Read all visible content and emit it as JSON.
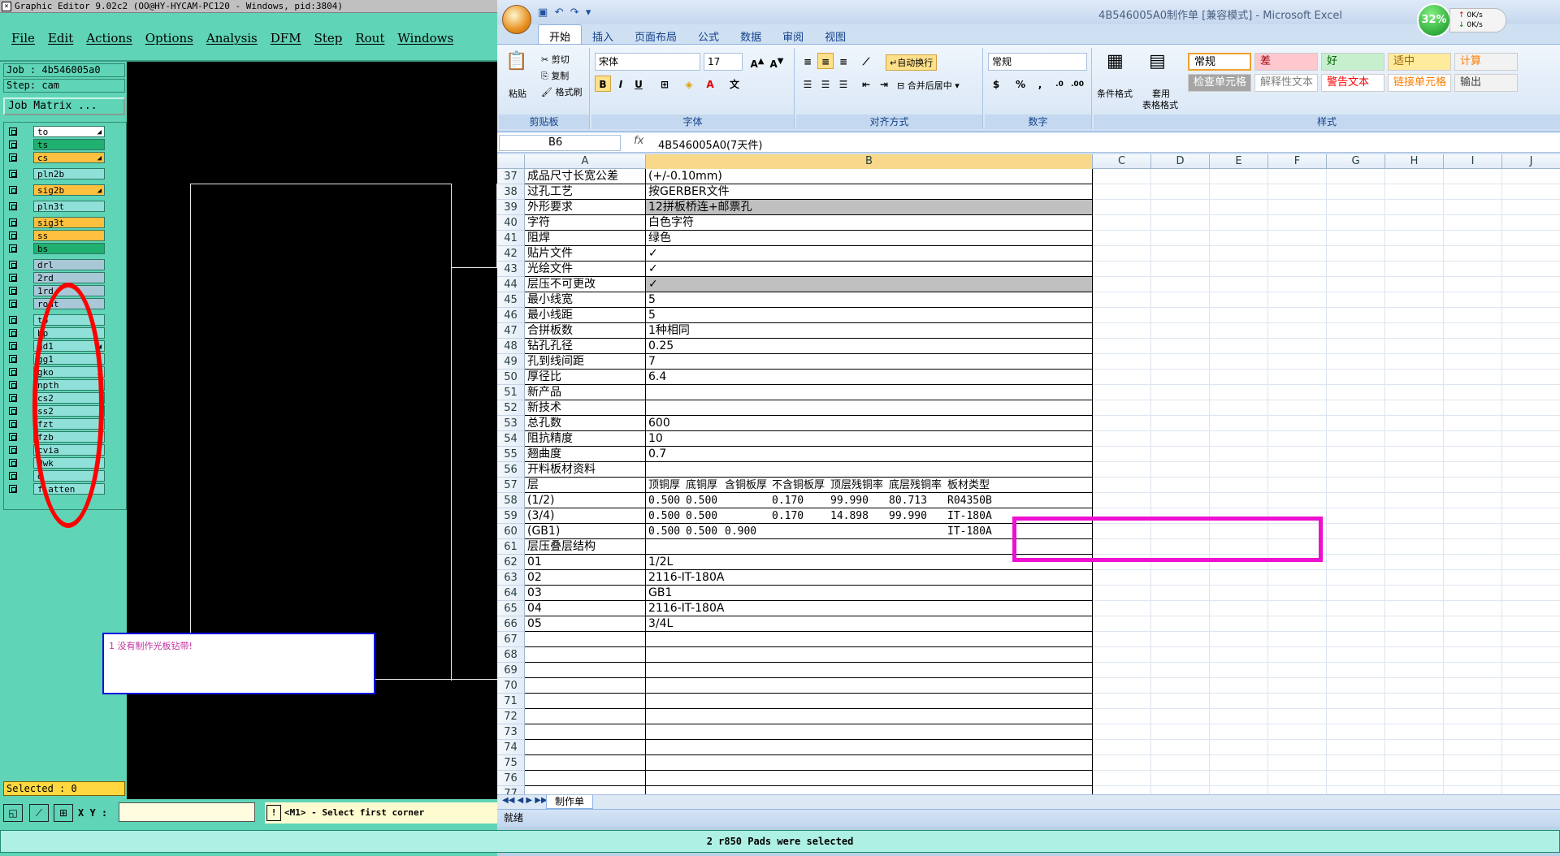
{
  "ge": {
    "title": "Graphic Editor 9.02c2 (OO@HY-HYCAM-PC120 - Windows, pid:3804)",
    "menu": [
      "File",
      "Edit",
      "Actions",
      "Options",
      "Analysis",
      "DFM",
      "Step",
      "Rout",
      "Windows"
    ],
    "job": "Job : 4b546005a0",
    "step": "Step: cam",
    "job_matrix": "Job Matrix ...",
    "layers": [
      {
        "name": "to",
        "color": "#ffffff",
        "arrow": true
      },
      {
        "name": "ts",
        "color": "#20b070",
        "arrow": false
      },
      {
        "name": "cs",
        "color": "#ffc040",
        "arrow": true
      },
      {
        "name": "pln2b",
        "color": "#8fe0d8",
        "arrow": false
      },
      {
        "name": "sig2b",
        "color": "#ffc040",
        "arrow": true
      },
      {
        "name": "pln3t",
        "color": "#8fe0d8",
        "arrow": false
      },
      {
        "name": "sig3t",
        "color": "#ffc040",
        "arrow": false
      },
      {
        "name": "ss",
        "color": "#ffc040",
        "arrow": false
      },
      {
        "name": "bs",
        "color": "#20b070",
        "arrow": false
      },
      {
        "name": "drl",
        "color": "#a8c8d8",
        "arrow": false
      },
      {
        "name": "2rd",
        "color": "#a8c8d8",
        "arrow": false
      },
      {
        "name": "1rd",
        "color": "#a8c8d8",
        "arrow": false
      },
      {
        "name": "rout",
        "color": "#a8c8d8",
        "arrow": false
      },
      {
        "name": "tp",
        "color": "#8fe0d8",
        "arrow": false
      },
      {
        "name": "bp",
        "color": "#8fe0d8",
        "arrow": false
      },
      {
        "name": "gd1",
        "color": "#8fe0d8",
        "arrow": true
      },
      {
        "name": "gg1",
        "color": "#8fe0d8",
        "arrow": false
      },
      {
        "name": "gko",
        "color": "#8fe0d8",
        "arrow": true
      },
      {
        "name": "npth",
        "color": "#8fe0d8",
        "arrow": false
      },
      {
        "name": "cs2",
        "color": "#8fe0d8",
        "arrow": false
      },
      {
        "name": "ss2",
        "color": "#8fe0d8",
        "arrow": false
      },
      {
        "name": "fzt",
        "color": "#8fe0d8",
        "arrow": false
      },
      {
        "name": "fzb",
        "color": "#8fe0d8",
        "arrow": false
      },
      {
        "name": "cvia",
        "color": "#8fe0d8",
        "arrow": false
      },
      {
        "name": "dwk",
        "color": "#8fe0d8",
        "arrow": false
      },
      {
        "name": "d",
        "color": "#8fe0d8",
        "arrow": false
      },
      {
        "name": "flatten",
        "color": "#8fe0d8",
        "arrow": false
      }
    ],
    "message": "1  没有制作光板钻带!",
    "selected": "Selected : 0",
    "xy_label": "X Y :",
    "prompt": "<M1> - Select first corner",
    "status": "2 r850 Pads were selected"
  },
  "xl": {
    "title": "4B546005A0制作单  [兼容模式] - Microsoft Excel",
    "net": {
      "percent": "32%",
      "up": "0K/s",
      "down": "0K/s"
    },
    "tabs": [
      "开始",
      "插入",
      "页面布局",
      "公式",
      "数据",
      "审阅",
      "视图"
    ],
    "ribbon": {
      "paste": "粘贴",
      "cut": "剪切",
      "copy": "复制",
      "format_painter": "格式刷",
      "clipboard": "剪贴板",
      "font_name": "宋体",
      "font_size": "17",
      "font": "字体",
      "wrap": "自动换行",
      "merge": "合并后居中",
      "alignment": "对齐方式",
      "number_format": "常规",
      "number": "数字",
      "cond_format": "条件格式",
      "table_format_1": "套用",
      "table_format_2": "表格格式",
      "styles": "样式",
      "style_cells": [
        {
          "label": "常规",
          "bg": "#ffffff",
          "fg": "#000000"
        },
        {
          "label": "差",
          "bg": "#ffc7ce",
          "fg": "#9c0006"
        },
        {
          "label": "好",
          "bg": "#c6efce",
          "fg": "#006100"
        },
        {
          "label": "适中",
          "bg": "#ffeb9c",
          "fg": "#9c6500"
        },
        {
          "label": "计算",
          "bg": "#f2f2f2",
          "fg": "#fa7d00"
        },
        {
          "label": "检查单元格",
          "bg": "#a5a5a5",
          "fg": "#ffffff"
        },
        {
          "label": "解释性文本",
          "bg": "#ffffff",
          "fg": "#7f7f7f"
        },
        {
          "label": "警告文本",
          "bg": "#ffffff",
          "fg": "#ff0000"
        },
        {
          "label": "链接单元格",
          "bg": "#ffffff",
          "fg": "#fa7d00"
        },
        {
          "label": "输出",
          "bg": "#f2f2f2",
          "fg": "#3f3f3f"
        }
      ]
    },
    "name_box": "B6",
    "fx": "fx",
    "formula": "4B546005A0(7天件)",
    "columns": [
      "A",
      "B",
      "C",
      "D",
      "E",
      "F",
      "G",
      "H",
      "I",
      "J"
    ],
    "rows": [
      {
        "n": "37",
        "a": "成品尺寸长宽公差",
        "b": "(+/-0.10mm)"
      },
      {
        "n": "38",
        "a": "过孔工艺",
        "b": "按GERBER文件"
      },
      {
        "n": "39",
        "a": "外形要求",
        "b": "12拼板桥连+邮票孔",
        "gray": true
      },
      {
        "n": "40",
        "a": "字符",
        "b": "白色字符"
      },
      {
        "n": "41",
        "a": "阻焊",
        "b": "绿色"
      },
      {
        "n": "42",
        "a": "贴片文件",
        "b": "✓"
      },
      {
        "n": "43",
        "a": "光绘文件",
        "b": "✓"
      },
      {
        "n": "44",
        "a": "层压不可更改",
        "b": "✓",
        "gray": true
      },
      {
        "n": "45",
        "a": "最小线宽",
        "b": "5"
      },
      {
        "n": "46",
        "a": "最小线距",
        "b": "5"
      },
      {
        "n": "47",
        "a": "合拼板数",
        "b": "1种相同"
      },
      {
        "n": "48",
        "a": "钻孔孔径",
        "b": "0.25"
      },
      {
        "n": "49",
        "a": "孔到线间距",
        "b": "7"
      },
      {
        "n": "50",
        "a": "厚径比",
        "b": "6.4"
      },
      {
        "n": "51",
        "a": "新产品",
        "b": ""
      },
      {
        "n": "52",
        "a": "新技术",
        "b": ""
      },
      {
        "n": "53",
        "a": "总孔数",
        "b": "600"
      },
      {
        "n": "54",
        "a": "阻抗精度",
        "b": "10"
      },
      {
        "n": "55",
        "a": "翘曲度",
        "b": "0.7"
      },
      {
        "n": "56",
        "a": "开料板材资料",
        "b": ""
      },
      {
        "n": "57",
        "a": "层",
        "b": "",
        "sub": [
          "顶铜厚",
          "底铜厚",
          "含铜板厚",
          "不含铜板厚",
          "顶层残铜率",
          "底层残铜率",
          "板材类型"
        ]
      },
      {
        "n": "58",
        "a": "(1/2)",
        "b": "",
        "sub": [
          "0.500",
          "0.500",
          "",
          "0.170",
          "99.990",
          "80.713",
          "R04350B"
        ]
      },
      {
        "n": "59",
        "a": "(3/4)",
        "b": "",
        "sub": [
          "0.500",
          "0.500",
          "",
          "0.170",
          "14.898",
          "99.990",
          "IT-180A"
        ]
      },
      {
        "n": "60",
        "a": "(GB1)",
        "b": "",
        "sub": [
          "0.500",
          "0.500",
          "0.900",
          "",
          "",
          "",
          "IT-180A"
        ]
      },
      {
        "n": "61",
        "a": "层压叠层结构",
        "b": ""
      },
      {
        "n": "62",
        "a": "01",
        "b": "1/2L"
      },
      {
        "n": "63",
        "a": "02",
        "b": "2116-IT-180A"
      },
      {
        "n": "64",
        "a": "03",
        "b": "GB1"
      },
      {
        "n": "65",
        "a": "04",
        "b": "2116-IT-180A"
      },
      {
        "n": "66",
        "a": "05",
        "b": "3/4L"
      },
      {
        "n": "67",
        "a": "",
        "b": ""
      },
      {
        "n": "68",
        "a": "",
        "b": ""
      },
      {
        "n": "69",
        "a": "",
        "b": ""
      },
      {
        "n": "70",
        "a": "",
        "b": ""
      },
      {
        "n": "71",
        "a": "",
        "b": ""
      },
      {
        "n": "72",
        "a": "",
        "b": ""
      },
      {
        "n": "73",
        "a": "",
        "b": ""
      },
      {
        "n": "74",
        "a": "",
        "b": ""
      },
      {
        "n": "75",
        "a": "",
        "b": ""
      },
      {
        "n": "76",
        "a": "",
        "b": ""
      },
      {
        "n": "77",
        "a": "",
        "b": ""
      }
    ],
    "sheet_tab": "制作单",
    "status": "就绪"
  }
}
